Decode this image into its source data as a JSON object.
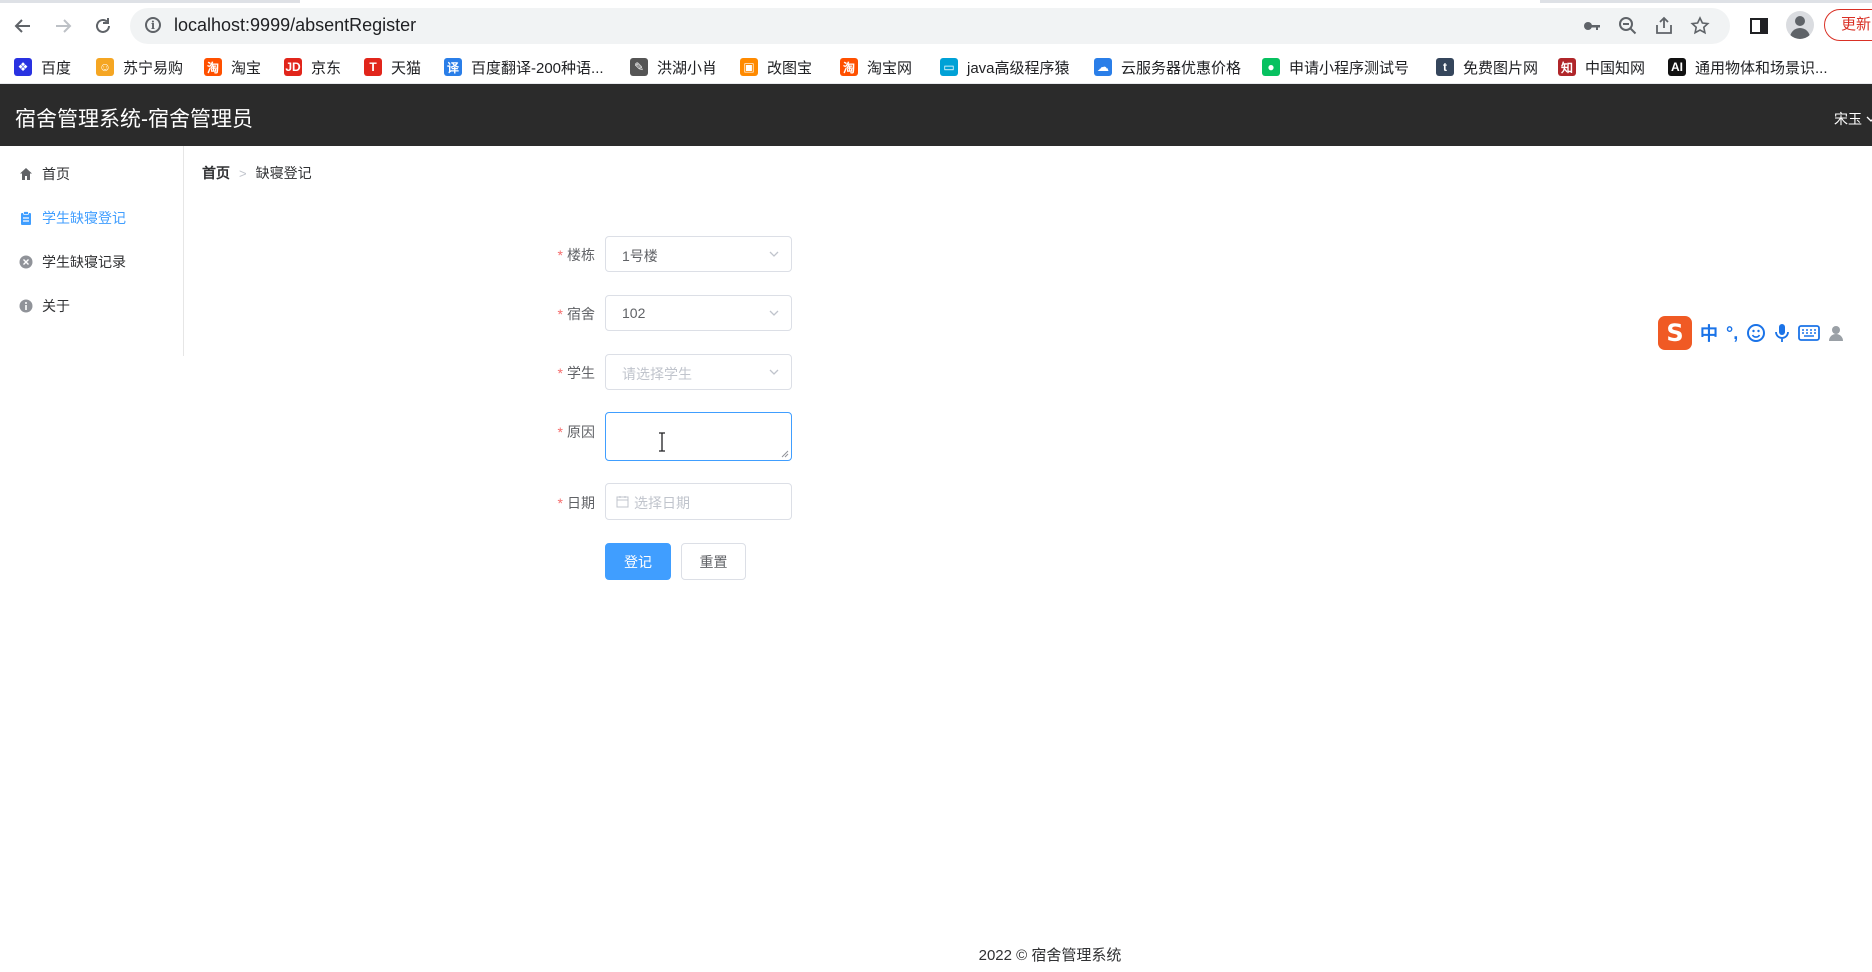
{
  "browser": {
    "url": "localhost:9999/absentRegister",
    "update_label": "更新",
    "bookmarks": [
      {
        "label": "百度",
        "icon": "baidu-paw-icon",
        "color": "#2932e1"
      },
      {
        "label": "苏宁易购",
        "icon": "suning-lion-icon",
        "color": "#f5a623"
      },
      {
        "label": "淘宝",
        "icon": "taobao-icon",
        "color": "#ff5000"
      },
      {
        "label": "京东",
        "icon": "jd-icon",
        "color": "#e1251b"
      },
      {
        "label": "天猫",
        "icon": "tmall-icon",
        "color": "#e1251b"
      },
      {
        "label": "百度翻译-200种语...",
        "icon": "translate-icon",
        "color": "#2a7ee8"
      },
      {
        "label": "洪湖小肖",
        "icon": "feather-icon",
        "color": "#555555"
      },
      {
        "label": "改图宝",
        "icon": "image-tool-icon",
        "color": "#ff8a00"
      },
      {
        "label": "淘宝网",
        "icon": "taobao-icon",
        "color": "#ff5000"
      },
      {
        "label": "java高级程序猿",
        "icon": "bilibili-tv-icon",
        "color": "#00a1d6"
      },
      {
        "label": "云服务器优惠价格",
        "icon": "cloud-icon",
        "color": "#2a7ee8"
      },
      {
        "label": "申请小程序测试号",
        "icon": "wechat-icon",
        "color": "#07c160"
      },
      {
        "label": "免费图片网",
        "icon": "tumblr-icon",
        "color": "#35465c"
      },
      {
        "label": "中国知网",
        "icon": "cnki-icon",
        "color": "#b0262a"
      },
      {
        "label": "通用物体和场景识...",
        "icon": "ai-icon",
        "color": "#111111"
      }
    ]
  },
  "app": {
    "title": "宿舍管理系统-宿舍管理员",
    "user_name": "宋玉",
    "header_bg": "#2b2b2b",
    "accent": "#409eff"
  },
  "sidebar": {
    "items": [
      {
        "label": "首页",
        "icon": "home-icon",
        "active": false
      },
      {
        "label": "学生缺寝登记",
        "icon": "clipboard-icon",
        "active": true
      },
      {
        "label": "学生缺寝记录",
        "icon": "circle-close-icon",
        "active": false
      },
      {
        "label": "关于",
        "icon": "info-icon",
        "active": false
      }
    ]
  },
  "breadcrumb": {
    "home": "首页",
    "separator": ">",
    "current": "缺寝登记"
  },
  "form": {
    "required_mark": "*",
    "building": {
      "label": "楼栋",
      "value": "1号楼"
    },
    "room": {
      "label": "宿舍",
      "value": "102"
    },
    "student": {
      "label": "学生",
      "placeholder": "请选择学生"
    },
    "reason": {
      "label": "原因",
      "value": ""
    },
    "date": {
      "label": "日期",
      "placeholder": "选择日期"
    },
    "submit_label": "登记",
    "reset_label": "重置"
  },
  "ime": {
    "logo": "S",
    "mode": "中"
  },
  "footer": {
    "text": "2022 © 宿舍管理系统"
  }
}
